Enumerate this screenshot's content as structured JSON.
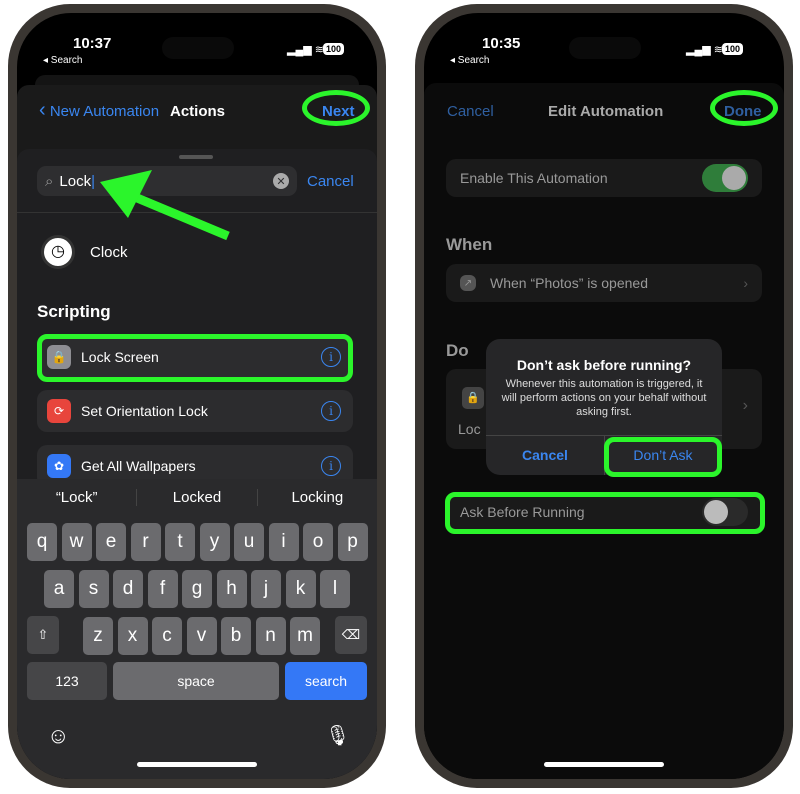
{
  "left": {
    "status": {
      "time": "10:37",
      "back": "◂ Search",
      "battery": "100"
    },
    "nav": {
      "back": "New Automation",
      "title": "Actions",
      "next": "Next"
    },
    "search": {
      "value": "Lock",
      "cancel": "Cancel"
    },
    "top_result": "Clock",
    "section": "Scripting",
    "actions": [
      {
        "label": "Lock Screen",
        "icon": "lock-icon",
        "color": "#8e8e93"
      },
      {
        "label": "Set Orientation Lock",
        "icon": "orientation-lock-icon",
        "color": "#e8453c"
      },
      {
        "label": "Get All Wallpapers",
        "icon": "flower-icon",
        "color": "#3478f6"
      }
    ],
    "suggestions": [
      "“Lock”",
      "Locked",
      "Locking"
    ],
    "keys": {
      "row1": [
        "q",
        "w",
        "e",
        "r",
        "t",
        "y",
        "u",
        "i",
        "o",
        "p"
      ],
      "row2": [
        "a",
        "s",
        "d",
        "f",
        "g",
        "h",
        "j",
        "k",
        "l"
      ],
      "row3": [
        "z",
        "x",
        "c",
        "v",
        "b",
        "n",
        "m"
      ],
      "numbers": "123",
      "space": "space",
      "search": "search"
    }
  },
  "right": {
    "status": {
      "time": "10:35",
      "back": "◂ Search",
      "battery": "100"
    },
    "nav": {
      "cancel": "Cancel",
      "title": "Edit Automation",
      "done": "Done"
    },
    "enable": {
      "label": "Enable This Automation",
      "on": true
    },
    "when_header": "When",
    "when_row": "When “Photos” is opened",
    "do_header": "Do",
    "do_partial": "Loc",
    "alert": {
      "title": "Don’t ask before running?",
      "message": "Whenever this automation is triggered, it will perform actions on your behalf without asking first.",
      "cancel": "Cancel",
      "confirm": "Don’t Ask"
    },
    "ask": {
      "label": "Ask Before Running",
      "on": false
    }
  },
  "colors": {
    "accent": "#3a86f0",
    "highlight": "#2bf52b",
    "toggle_on": "#2f7d3a"
  }
}
